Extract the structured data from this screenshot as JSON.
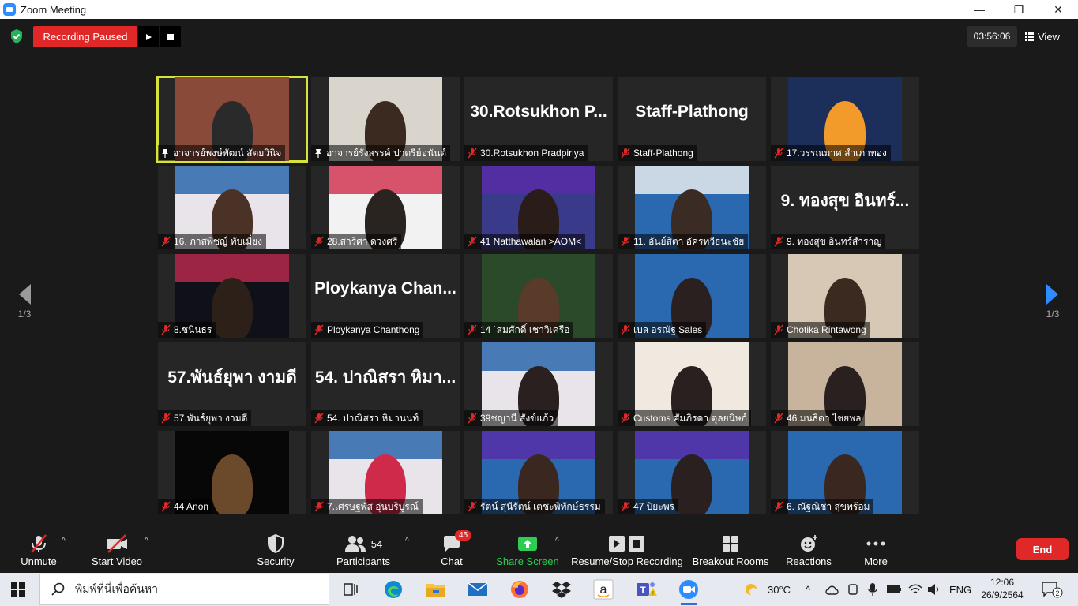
{
  "window": {
    "title": "Zoom Meeting"
  },
  "topbar": {
    "recording_status": "Recording Paused",
    "timer": "03:56:06",
    "view_label": "View"
  },
  "pagination": {
    "left": "1/3",
    "right": "1/3"
  },
  "tiles": [
    {
      "label": "อาจารย์พงษ์พัฒน์ สัตยวินิจ",
      "name_display": "",
      "pinned": true,
      "active": true
    },
    {
      "label": "อาจารย์รังสรรค์ ปาตรีย์อนันต์",
      "name_display": "",
      "pinned": true
    },
    {
      "label": "30.Rotsukhon Pradpiriya",
      "name_display": "30.Rotsukhon P..."
    },
    {
      "label": "Staff-Plathong",
      "name_display": "Staff-Plathong"
    },
    {
      "label": "17.วรรณมาศ ลำเภาทอง",
      "name_display": ""
    },
    {
      "label": "16. ภาสพิชญ์ ทับเมี่ยง",
      "name_display": ""
    },
    {
      "label": "28.สาริศา ดวงศรี",
      "name_display": ""
    },
    {
      "label": "41 Natthawalan >AOM<",
      "name_display": ""
    },
    {
      "label": "11. อันย์สิตา อัครทวีธนะชัย",
      "name_display": ""
    },
    {
      "label": "9. ทองสุข อินทร์สำราญ",
      "name_display": "9. ทองสุข อินทร์..."
    },
    {
      "label": "8.ชนินธร",
      "name_display": ""
    },
    {
      "label": "Ploykanya Chanthong",
      "name_display": "Ploykanya Chan..."
    },
    {
      "label": "14 `สมศักดิ์ เชาวิเครือ",
      "name_display": ""
    },
    {
      "label": "เบล อรณัฐ Sales",
      "name_display": ""
    },
    {
      "label": "Chotika Rintawong",
      "name_display": ""
    },
    {
      "label": "57.พันธ์ยุพา งามดี",
      "name_display": "57.พันธ์ยุพา งามดี"
    },
    {
      "label": "54. ปาณิสรา หิมานนท์",
      "name_display": "54. ปาณิสรา หิมา..."
    },
    {
      "label": "39ชญานี สังข์แก้ว",
      "name_display": ""
    },
    {
      "label": "Customs ศัมภิรดา ตุลยนิษก์",
      "name_display": ""
    },
    {
      "label": "46.มนธิดา ไชยพล",
      "name_display": ""
    },
    {
      "label": "44 Anon",
      "name_display": ""
    },
    {
      "label": "7.เศรษฐพัส อุ่นบริบูรณ์",
      "name_display": ""
    },
    {
      "label": "รัตน์ สุนีรัตน์ เตชะพิทักษ์ธรรม",
      "name_display": ""
    },
    {
      "label": "47 ปิยะพร",
      "name_display": ""
    },
    {
      "label": "6. ณัฐณิชา สุขพร้อม",
      "name_display": ""
    }
  ],
  "toolbar": {
    "unmute": "Unmute",
    "start_video": "Start Video",
    "security": "Security",
    "participants": "Participants",
    "participants_count": "54",
    "chat": "Chat",
    "chat_badge": "45",
    "share_screen": "Share Screen",
    "resume_stop_recording": "Resume/Stop Recording",
    "breakout_rooms": "Breakout Rooms",
    "reactions": "Reactions",
    "more": "More",
    "end": "End"
  },
  "taskbar": {
    "search_placeholder": "พิมพ์ที่นี่เพื่อค้นหา",
    "weather": "30°C",
    "language": "ENG",
    "time": "12:06",
    "date": "26/9/2564",
    "notification_count": "2"
  },
  "colors": {
    "recording_red": "#e02828",
    "active_speaker": "#d7e33a",
    "share_green": "#2ecc52",
    "nav_blue": "#2d8cff",
    "background": "#1a1a1a"
  }
}
